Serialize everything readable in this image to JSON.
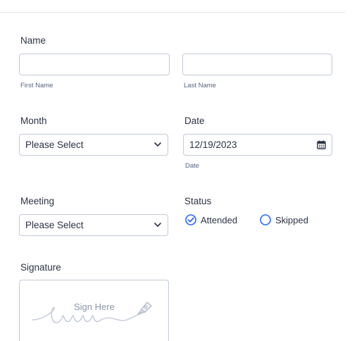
{
  "name": {
    "label": "Name",
    "first_sublabel": "First Name",
    "last_sublabel": "Last Name",
    "first_value": "",
    "last_value": ""
  },
  "month": {
    "label": "Month",
    "selected": "Please Select"
  },
  "date": {
    "label": "Date",
    "value": "12/19/2023",
    "sublabel": "Date"
  },
  "meeting": {
    "label": "Meeting",
    "selected": "Please Select"
  },
  "status": {
    "label": "Status",
    "options": [
      {
        "label": "Attended",
        "checked": true
      },
      {
        "label": "Skipped",
        "checked": false
      }
    ]
  },
  "signature": {
    "label": "Signature",
    "hint": "Sign Here"
  },
  "colors": {
    "accent": "#2e69ff",
    "border": "#c3cad8",
    "text": "#2c3345"
  }
}
